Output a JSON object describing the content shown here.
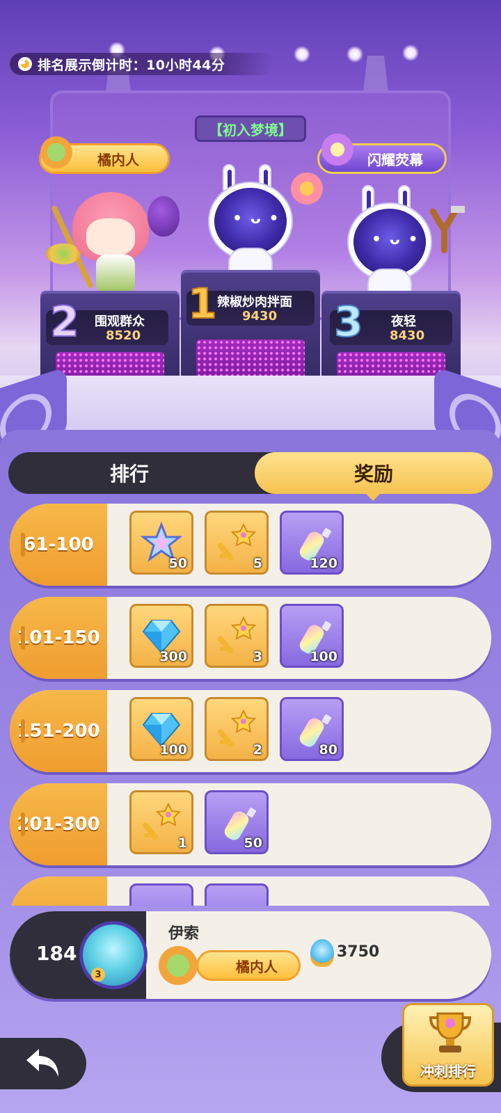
{
  "countdown": {
    "label": "排名展示倒计时：",
    "value": "10小时44分"
  },
  "season": {
    "title": "【初入梦境】"
  },
  "titles": {
    "left_badge": "橘内人",
    "right_badge": "闪耀荧幕"
  },
  "podium": [
    {
      "rank": "1",
      "name": "辣椒炒肉拌面",
      "score": "9430"
    },
    {
      "rank": "2",
      "name": "围观群众",
      "score": "8520"
    },
    {
      "rank": "3",
      "name": "夜轻",
      "score": "8430"
    }
  ],
  "tabs": {
    "rank": "排行",
    "reward": "奖励"
  },
  "rewards": [
    {
      "range": "61-100",
      "items": [
        {
          "icon": "crystal-star-icon",
          "qty": "50"
        },
        {
          "icon": "star-key-icon",
          "qty": "5"
        },
        {
          "icon": "rainbow-bottle-icon",
          "qty": "120"
        }
      ]
    },
    {
      "range": "101-150",
      "items": [
        {
          "icon": "blue-diamond-icon",
          "qty": "300"
        },
        {
          "icon": "star-key-icon",
          "qty": "3"
        },
        {
          "icon": "rainbow-bottle-icon",
          "qty": "100"
        }
      ]
    },
    {
      "range": "151-200",
      "items": [
        {
          "icon": "blue-diamond-icon",
          "qty": "100"
        },
        {
          "icon": "star-key-icon",
          "qty": "2"
        },
        {
          "icon": "rainbow-bottle-icon",
          "qty": "80"
        }
      ]
    },
    {
      "range": "201-300",
      "items": [
        {
          "icon": "star-key-icon",
          "qty": "1"
        },
        {
          "icon": "rainbow-bottle-icon",
          "qty": "50"
        }
      ]
    }
  ],
  "me": {
    "rank": "184",
    "name": "伊索",
    "badge": "橘内人",
    "score": "3750",
    "avatar_level": "3"
  },
  "buttons": {
    "sprint": "冲刺排行"
  },
  "colors": {
    "accent_orange": "#f6c251",
    "panel_purple": "#8a76dc",
    "dark": "#2f2e3a"
  }
}
